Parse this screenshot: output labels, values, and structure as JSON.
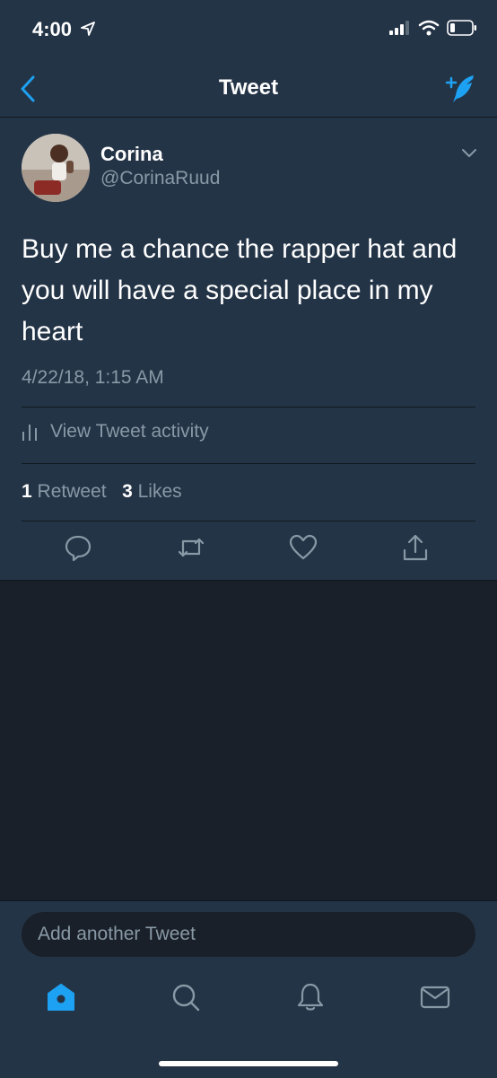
{
  "status_bar": {
    "time": "4:00"
  },
  "nav": {
    "title": "Tweet"
  },
  "tweet": {
    "display_name": "Corina",
    "handle": "@CorinaRuud",
    "text": "Buy me a chance the rapper hat and you will have a special place in my heart",
    "timestamp": "4/22/18, 1:15 AM",
    "activity_label": "View Tweet activity",
    "retweets": {
      "count": "1",
      "label": "Retweet"
    },
    "likes": {
      "count": "3",
      "label": "Likes"
    }
  },
  "reply": {
    "placeholder": "Add another Tweet"
  },
  "tabs": [
    {
      "name": "home",
      "icon": "home-icon",
      "active": true
    },
    {
      "name": "search",
      "icon": "search-icon",
      "active": false
    },
    {
      "name": "notifications",
      "icon": "bell-icon",
      "active": false
    },
    {
      "name": "messages",
      "icon": "mail-icon",
      "active": false
    }
  ],
  "colors": {
    "accent": "#1da1f2",
    "background": "#1a2029",
    "surface": "#243447",
    "secondary_text": "#8899a6"
  }
}
